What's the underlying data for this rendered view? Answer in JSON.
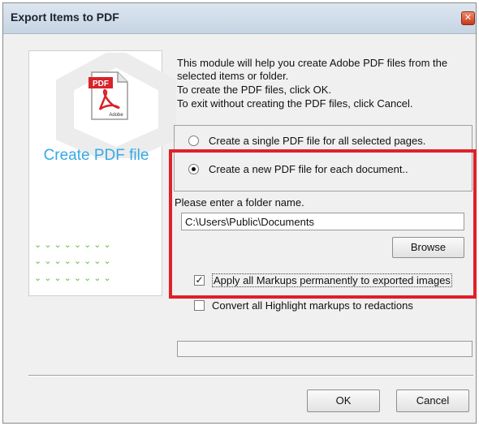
{
  "window": {
    "title": "Export Items to PDF",
    "close_glyph": "✕"
  },
  "left_panel": {
    "logo_text": "PDF",
    "logo_sub": "Adobe",
    "heading": "Create PDF file",
    "dots_row": "⌄⌄⌄⌄⌄⌄⌄⌄",
    "accent_color": "#35a9e6"
  },
  "intro": {
    "line1": "This module will help you create Adobe PDF files from the selected items or folder.",
    "line2": "To create the PDF files, click OK.",
    "line3": "To exit without creating the PDF files, click Cancel."
  },
  "options": {
    "single_pdf": {
      "label": "Create a single PDF file for all selected pages.",
      "selected": false
    },
    "new_pdf": {
      "label": "Create a new PDF file for each document..",
      "selected": true
    }
  },
  "folder": {
    "label": "Please enter a folder name.",
    "value": "C:\\Users\\Public\\Documents",
    "browse_label": "Browse"
  },
  "checkboxes": {
    "apply_markups": {
      "label": "Apply all Markups permanently to exported images",
      "checked": true,
      "mark": "✓"
    },
    "convert_highlight": {
      "label": "Convert all Highlight markups to redactions",
      "checked": false
    }
  },
  "buttons": {
    "ok": "OK",
    "cancel": "Cancel"
  },
  "colors": {
    "highlight": "#e0202a"
  }
}
